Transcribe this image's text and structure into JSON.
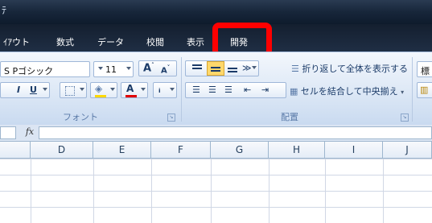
{
  "window": {
    "title_fragment": "ﾃ"
  },
  "tabs": [
    {
      "label": "ｲｱウト"
    },
    {
      "label": "数式"
    },
    {
      "label": "データ"
    },
    {
      "label": "校閲"
    },
    {
      "label": "表示"
    },
    {
      "label": "開発",
      "highlighted": true
    }
  ],
  "ribbon": {
    "font_group": {
      "font_name": "S Pゴシック",
      "font_size": "11",
      "label": "フォント",
      "grow_icon": "font-grow-icon",
      "shrink_icon": "font-shrink-icon"
    },
    "alignment_group": {
      "label": "配置",
      "wrap_text_label": "折り返して全体を表示する",
      "merge_center_label": "セルを結合して中央揃え"
    },
    "number_group": {
      "format_partial": "標"
    }
  },
  "formula_bar": {
    "fx_label": "fx",
    "value": ""
  },
  "columns": [
    "D",
    "E",
    "F",
    "G",
    "H",
    "I",
    "J"
  ],
  "colors": {
    "highlight_border": "#ff0000",
    "title_bar": "#17263a",
    "ribbon_bg": "#dde8f6",
    "header_text": "#27415f"
  }
}
